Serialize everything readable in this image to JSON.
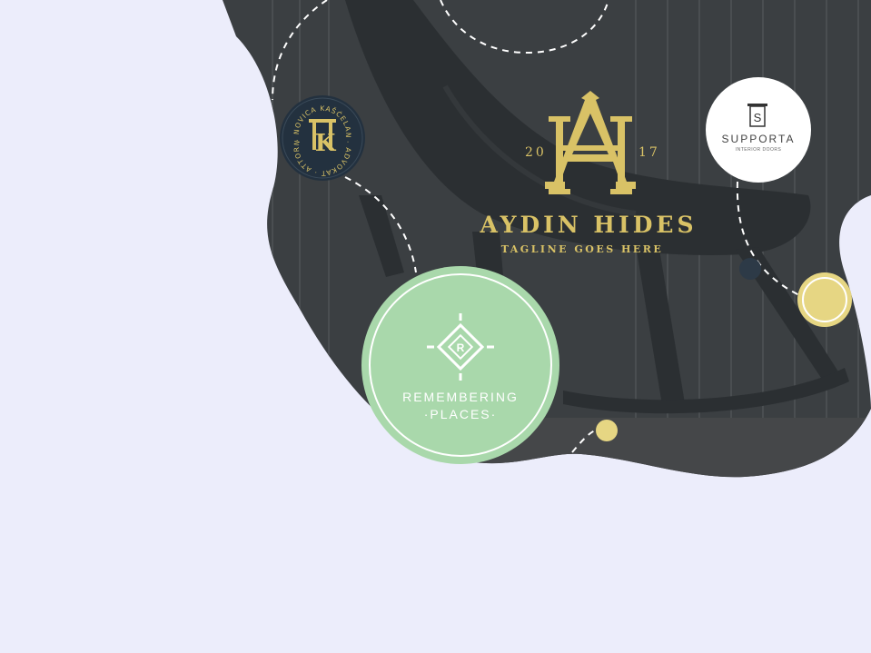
{
  "colors": {
    "background": "#ecedfb",
    "photo_dark": "#3b3f42",
    "blob_floor": "#454749",
    "gold": "#d9c266",
    "navy_badge": "#23313f",
    "mint": "#a9d8ab",
    "white": "#ffffff"
  },
  "hero_logo": {
    "year_left": "20",
    "year_right": "17",
    "monogram": "AH",
    "brand": "AYDIN HIDES",
    "tagline": "TAGLINE GOES HERE"
  },
  "law_badge": {
    "arc_text": "· NOVICA KAŠĆELAN · ADVOKAT · ATTORNEY AT LAW ·",
    "initial": "K"
  },
  "supporta": {
    "name": "SUPPORTA",
    "subtitle": "INTERIOR DOORS",
    "mark": "S"
  },
  "remembering": {
    "line1": "REMEMBERING",
    "line2": "·PLACES·",
    "mark": "R"
  }
}
